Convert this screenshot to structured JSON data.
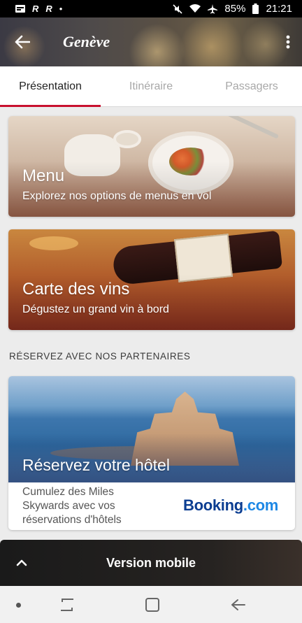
{
  "status_bar": {
    "battery": "85%",
    "time": "21:21",
    "icons": [
      "notification-icon",
      "r-app-icon",
      "r-app-icon",
      "mute-icon",
      "wifi-icon",
      "airplane-icon",
      "battery-icon"
    ]
  },
  "header": {
    "title": "Genève",
    "back_icon": "arrow-left-icon",
    "more_icon": "more-vertical-icon"
  },
  "tabs": [
    {
      "label": "Présentation",
      "active": true
    },
    {
      "label": "Itinéraire",
      "active": false
    },
    {
      "label": "Passagers",
      "active": false
    }
  ],
  "cards": {
    "menu": {
      "title": "Menu",
      "subtitle": "Explorez nos options de menus en vol"
    },
    "wine": {
      "title": "Carte des vins",
      "subtitle": "Dégustez un grand vin à bord"
    }
  },
  "partners": {
    "section_title": "RÉSERVEZ AVEC NOS PARTENAIRES",
    "hotel": {
      "title": "Réservez votre hôtel",
      "description": "Cumulez des Miles Skywards avec vos réservations d'hôtels",
      "logo_text": "Booking",
      "logo_suffix": ".com"
    }
  },
  "banner": {
    "label": "Version mobile",
    "chevron_icon": "chevron-up-icon"
  },
  "nav_bar": {
    "icons": [
      "recent-apps-icon",
      "home-icon",
      "back-icon"
    ]
  },
  "colors": {
    "accent": "#c8102e",
    "booking_blue": "#0b3d91",
    "booking_light": "#1e88e5"
  }
}
